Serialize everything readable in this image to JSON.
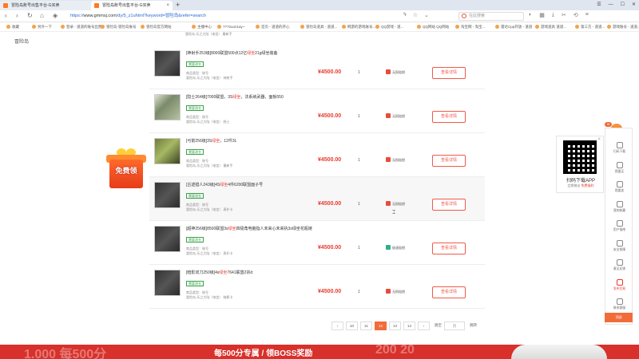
{
  "browser": {
    "tabs": [
      {
        "title": "冒险岛账号出售平台-G买卖",
        "active": false
      },
      {
        "title": "冒险岛账号出售平台-G买卖",
        "active": true
      }
    ],
    "new_tab": "+",
    "window_controls": [
      "☰",
      "—",
      "☐",
      "✕"
    ],
    "url_scheme": "https://",
    "url_domain": "www.gmmsj.com",
    "url_path": "/dy/5_z1uhtml?keyword=冒险岛&refer=search",
    "search_placeholder": "在此搜索",
    "bookmarks": [
      "收藏",
      "另外一下",
      "登录 - 道道的账号出售",
      "冒险岛-冒险岛账号",
      "冒险岛官方网站",
      "主播中心",
      "???2uon1ay~",
      "首页 - 道道的开心",
      "冒险岛道具 - 道道...",
      "网游的游戏账号...",
      "QQ游戏 - 道...",
      "QQ网站 QQ网站",
      "淘宝网 - 淘宝...",
      "雷达Cpp开放 - 道道",
      "游戏道具 道道...",
      "第三方 - 道道...",
      "游戏账号 - 道道..."
    ]
  },
  "page": {
    "left_logo": "冒险岛",
    "top_info": "冒险岛-乐之大陆（电信） 最新手"
  },
  "listings": [
    {
      "title_a": "[神射手253级]8000联盟500点12亿",
      "title_hl": "绿坐",
      "title_b": "21g绿坐装备",
      "tag": "需要改名",
      "meta1": "商品类型：账号",
      "meta2": "冒险岛-乐之大陆（电信） 神射手",
      "price": "¥4500.00",
      "qty": "1",
      "guarantee": "无损赔偿",
      "guarantee_type": "red",
      "button": "查看详情"
    },
    {
      "title_a": "[隐士264级]7000联盟，3S",
      "title_hl": "绿坐",
      "title_b": "，法系纳武器，面板550",
      "tag": "需要改名",
      "meta1": "商品类型：账号",
      "meta2": "冒险岛-乐之大陆（电信） 隐士",
      "price": "¥4500.00",
      "qty": "1",
      "guarantee": "无损赔偿",
      "guarantee_type": "red",
      "button": "查看详情"
    },
    {
      "title_a": "[弓箭256级]3S",
      "title_hl": "绿坐",
      "title_b": "，12件3L",
      "tag": "需要改名",
      "meta1": "商品类型：账号",
      "meta2": "冒险岛-乐之大陆（电信） 最新手",
      "price": "¥4500.00",
      "qty": "1",
      "guarantee": "无损赔偿",
      "guarantee_type": "red",
      "button": "查看详情"
    },
    {
      "title_a": "[古迹猎人243级]4S",
      "title_hl": "绿坐",
      "title_b": "4件6200联盟面子号",
      "tag": "需要改名",
      "meta1": "商品类型：账号",
      "meta2": "冒险岛-乐之大陆（电信） 表扑卡",
      "price": "¥4500.00",
      "qty": "1",
      "guarantee": "无损赔偿",
      "guarantee_type": "red",
      "button": "查看详情"
    },
    {
      "title_a": "[超神256级]8500联盟3s",
      "title_hl": "绿坐",
      "title_b": "四极角电脑指人未来心未来执3s绿坐花瓶链",
      "tag": "需要改名",
      "meta1": "商品类型：账号",
      "meta2": "冒险岛-乐之大陆（电信） 表扑卡",
      "price": "¥4500.00",
      "qty": "1",
      "guarantee": "极速赔偿",
      "guarantee_type": "green",
      "button": "查看详情"
    },
    {
      "title_a": "[暗影双刀250级]4s",
      "title_hl": "绿坐",
      "title_b": "7641联盟2宗d",
      "tag": "需要改名",
      "meta1": "商品类型：账号",
      "meta2": "冒险岛-乐之大陆（电信） 暗影卡",
      "price": "¥4500.00",
      "qty": "1",
      "guarantee": "无损赔偿",
      "guarantee_type": "red",
      "button": "查看详情"
    }
  ],
  "pagination": {
    "pages": [
      "10",
      "11",
      "12",
      "13",
      "14"
    ],
    "active": "12",
    "prev": "‹",
    "next": "›",
    "goto_label": "跳至",
    "goto_value": "页",
    "goto_button": "跳转"
  },
  "gift": {
    "label": "免费领"
  },
  "qr": {
    "title": "扫码下载APP",
    "sub_a": "定期赠送",
    "sub_b": "免费福利",
    "close": "×"
  },
  "sidebar": {
    "greeting": "Hi",
    "items": [
      "扫码下载",
      "我要买",
      "我要卖",
      "我的收藏",
      "用户指南",
      "安全保障",
      "意见反馈",
      "发布交易",
      "联系客服"
    ],
    "top_label": "顶部"
  },
  "banner": {
    "text": "每500分专属 / 领BOSS奖励",
    "ghost_left": "1.000 每500分",
    "ghost_right": "200 20 "
  },
  "colors": {
    "accent": "#f26c3a",
    "price": "#e83a2e",
    "banner": "#d8302a",
    "tag_green": "#3aa34a"
  }
}
